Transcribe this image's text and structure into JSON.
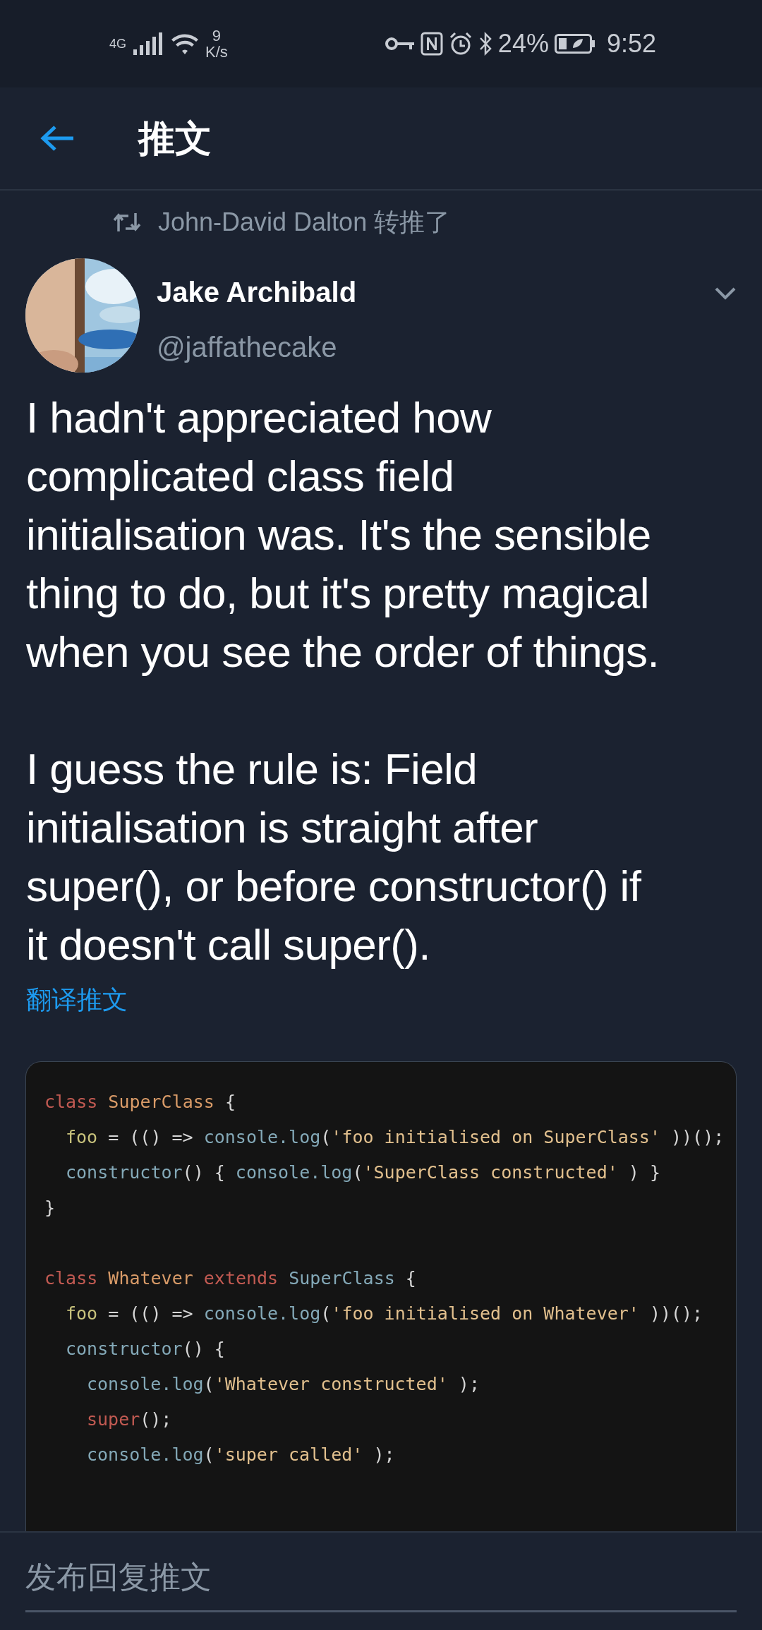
{
  "status_bar": {
    "network": "4G",
    "speed_value": "9",
    "speed_unit": "K/s",
    "battery": "24%",
    "time": "9:52"
  },
  "header": {
    "title": "推文"
  },
  "retweet": {
    "text": "John-David Dalton 转推了"
  },
  "author": {
    "name": "Jake Archibald",
    "handle": "@jaffathecake"
  },
  "tweet": {
    "paragraphs": [
      {
        "lines": [
          "I hadn't appreciated how",
          "complicated class field",
          "initialisation was. It's the sensible",
          "thing to do, but it's pretty magical",
          "when you see the order of things."
        ]
      },
      {
        "lines": [
          "I guess the rule is: Field",
          "initialisation is straight after",
          "super(), or before constructor() if",
          "it doesn't call super()."
        ]
      }
    ],
    "translate": "翻译推文"
  },
  "code_image": {
    "lines": [
      {
        "kind": "code",
        "tokens": [
          {
            "kind": "keyword",
            "text": "class"
          },
          {
            "kind": "classname",
            "text": "SuperClass"
          },
          {
            "kind": "punct",
            "text": "{"
          }
        ],
        "children": [
          {
            "kind": "code",
            "tokens": [
              {
                "kind": "prop",
                "text": "foo"
              },
              {
                "kind": "punct",
                "text": "= (() =>"
              },
              {
                "kind": "ident",
                "text": "console.log"
              },
              {
                "kind": "punct",
                "text": "("
              },
              {
                "kind": "string",
                "text": "'foo initialised on SuperClass'"
              },
              {
                "kind": "punct",
                "text": "))();"
              }
            ]
          },
          {
            "kind": "code",
            "tokens": [
              {
                "kind": "ident",
                "text": "constructor"
              },
              {
                "kind": "punct",
                "text": "() {"
              },
              {
                "kind": "ident",
                "text": "console.log"
              },
              {
                "kind": "punct",
                "text": "("
              },
              {
                "kind": "string",
                "text": "'SuperClass constructed'"
              },
              {
                "kind": "punct",
                "text": ") }"
              }
            ]
          }
        ]
      },
      {
        "kind": "code",
        "tokens": [
          {
            "kind": "punct",
            "text": "}"
          }
        ]
      },
      {
        "kind": "blank"
      },
      {
        "kind": "code",
        "tokens": [
          {
            "kind": "keyword",
            "text": "class"
          },
          {
            "kind": "classname",
            "text": "Whatever"
          },
          {
            "kind": "keyword",
            "text": "extends"
          },
          {
            "kind": "ident",
            "text": "SuperClass"
          },
          {
            "kind": "punct",
            "text": "{"
          }
        ],
        "children": [
          {
            "kind": "code",
            "tokens": [
              {
                "kind": "prop",
                "text": "foo"
              },
              {
                "kind": "punct",
                "text": "= (() =>"
              },
              {
                "kind": "ident",
                "text": "console.log"
              },
              {
                "kind": "punct",
                "text": "("
              },
              {
                "kind": "string",
                "text": "'foo initialised on Whatever'"
              },
              {
                "kind": "punct",
                "text": "))();"
              }
            ]
          },
          {
            "kind": "code",
            "tokens": [
              {
                "kind": "ident",
                "text": "constructor"
              },
              {
                "kind": "punct",
                "text": "() {"
              }
            ],
            "children": [
              {
                "kind": "code",
                "tokens": [
                  {
                    "kind": "ident",
                    "text": "console.log"
                  },
                  {
                    "kind": "punct",
                    "text": "("
                  },
                  {
                    "kind": "string",
                    "text": "'Whatever constructed'"
                  },
                  {
                    "kind": "punct",
                    "text": ");"
                  }
                ]
              },
              {
                "kind": "code",
                "tokens": [
                  {
                    "kind": "keyword",
                    "text": "super"
                  },
                  {
                    "kind": "punct",
                    "text": "();"
                  }
                ]
              },
              {
                "kind": "code",
                "tokens": [
                  {
                    "kind": "ident",
                    "text": "console.log"
                  },
                  {
                    "kind": "punct",
                    "text": "("
                  },
                  {
                    "kind": "string",
                    "text": "'super called'"
                  },
                  {
                    "kind": "punct",
                    "text": ");"
                  }
                ]
              }
            ]
          }
        ]
      }
    ]
  },
  "reply_bar": {
    "placeholder": "发布回复推文"
  }
}
